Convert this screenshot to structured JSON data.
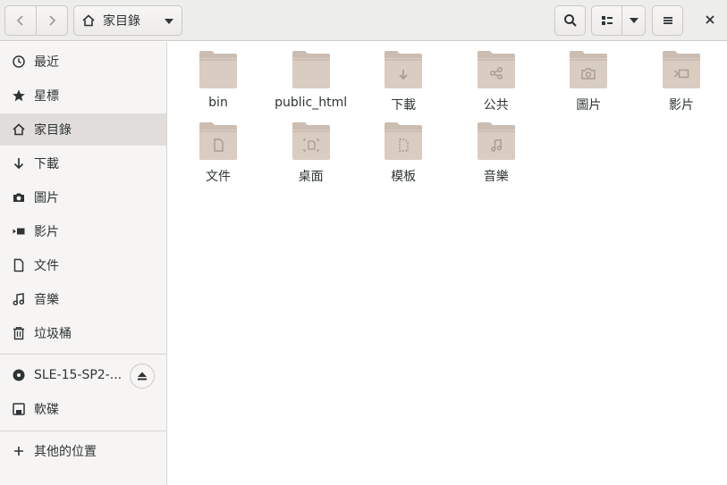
{
  "header": {
    "path_label": "家目錄"
  },
  "sidebar": {
    "items": [
      {
        "label": "最近",
        "icon": "clock-icon"
      },
      {
        "label": "星標",
        "icon": "star-icon"
      },
      {
        "label": "家目錄",
        "icon": "home-icon"
      },
      {
        "label": "下載",
        "icon": "download-arrow-icon"
      },
      {
        "label": "圖片",
        "icon": "camera-icon"
      },
      {
        "label": "影片",
        "icon": "video-icon"
      },
      {
        "label": "文件",
        "icon": "document-icon"
      },
      {
        "label": "音樂",
        "icon": "music-note-icon"
      },
      {
        "label": "垃圾桶",
        "icon": "trash-icon"
      }
    ],
    "devices": [
      {
        "label": "SLE-15-SP2-...",
        "icon": "optical-disc-icon"
      },
      {
        "label": "軟碟",
        "icon": "floppy-icon"
      }
    ],
    "other": {
      "label": "其他的位置",
      "icon": "plus-icon"
    }
  },
  "files": [
    {
      "label": "bin",
      "icon": "folder-icon"
    },
    {
      "label": "public_html",
      "icon": "folder-icon"
    },
    {
      "label": "下載",
      "icon": "folder-download-icon"
    },
    {
      "label": "公共",
      "icon": "folder-share-icon"
    },
    {
      "label": "圖片",
      "icon": "folder-pictures-icon"
    },
    {
      "label": "影片",
      "icon": "folder-videos-icon"
    },
    {
      "label": "文件",
      "icon": "folder-documents-icon"
    },
    {
      "label": "桌面",
      "icon": "folder-desktop-icon"
    },
    {
      "label": "模板",
      "icon": "folder-templates-icon"
    },
    {
      "label": "音樂",
      "icon": "folder-music-icon"
    }
  ],
  "colors": {
    "folder_body": "#d9ccc1",
    "folder_tab": "#cbbdb1",
    "folder_glyph": "#a99a8d",
    "selected_sidebar": "#e0ddda"
  }
}
